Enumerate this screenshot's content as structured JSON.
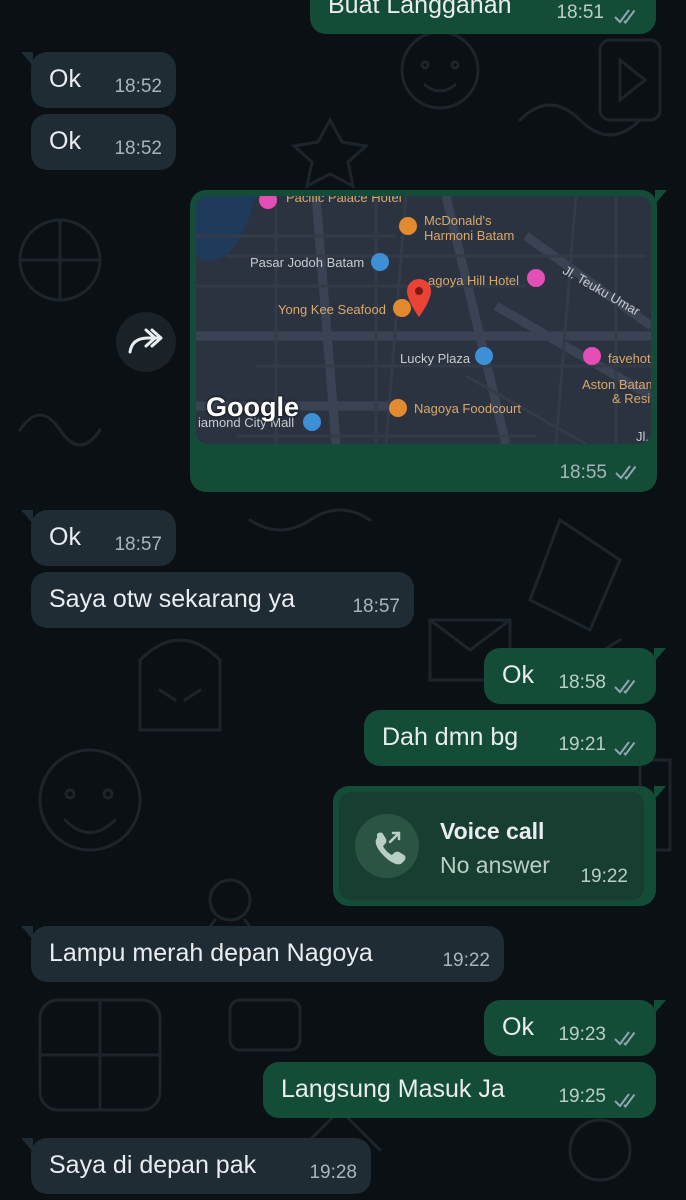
{
  "colors": {
    "background": "#0b1014",
    "incoming_bubble": "#1f2c34",
    "outgoing_bubble": "#144d37",
    "read_ticks": "#8fa6b2"
  },
  "messages": [
    {
      "id": "m0",
      "direction": "out",
      "text": "Buat Langganan",
      "time": "18:51",
      "ticks": "double"
    },
    {
      "id": "m1",
      "direction": "in",
      "text": "Ok",
      "time": "18:52"
    },
    {
      "id": "m2",
      "direction": "in",
      "text": "Ok",
      "time": "18:52"
    },
    {
      "id": "m4",
      "direction": "in",
      "text": "Ok",
      "time": "18:57"
    },
    {
      "id": "m5",
      "direction": "in",
      "text": "Saya otw sekarang ya",
      "time": "18:57"
    },
    {
      "id": "m6",
      "direction": "out",
      "text": "Ok",
      "time": "18:58",
      "ticks": "double"
    },
    {
      "id": "m7",
      "direction": "out",
      "text": "Dah dmn bg",
      "time": "19:21",
      "ticks": "double"
    },
    {
      "id": "m9",
      "direction": "in",
      "text": "Lampu merah depan Nagoya",
      "time": "19:22"
    },
    {
      "id": "m10",
      "direction": "out",
      "text": "Ok",
      "time": "19:23",
      "ticks": "double"
    },
    {
      "id": "m11",
      "direction": "out",
      "text": "Langsung Masuk Ja",
      "time": "19:25",
      "ticks": "double"
    },
    {
      "id": "m12",
      "direction": "in",
      "text": "Saya di depan pak",
      "time": "19:28"
    }
  ],
  "location_message": {
    "time": "18:55",
    "ticks": "double",
    "map_brand": "Google",
    "places": [
      "Pacific Palace Hotel",
      "McDonald's",
      "Harmoni Batam",
      "Pasar Jodoh Batam",
      "agoya Hill Hotel",
      "Jl. Teuku Umar",
      "Yong Kee Seafood",
      "Lucky Plaza",
      "favehot",
      "Aston Batam",
      "& Resi",
      "iamond City Mall",
      "Nagoya Foodcourt",
      "Jl."
    ]
  },
  "voice_call": {
    "title": "Voice call",
    "status": "No answer",
    "time": "19:22",
    "icon": "missed-outgoing-call-icon"
  },
  "forward_button": {
    "icon": "forward-icon"
  }
}
